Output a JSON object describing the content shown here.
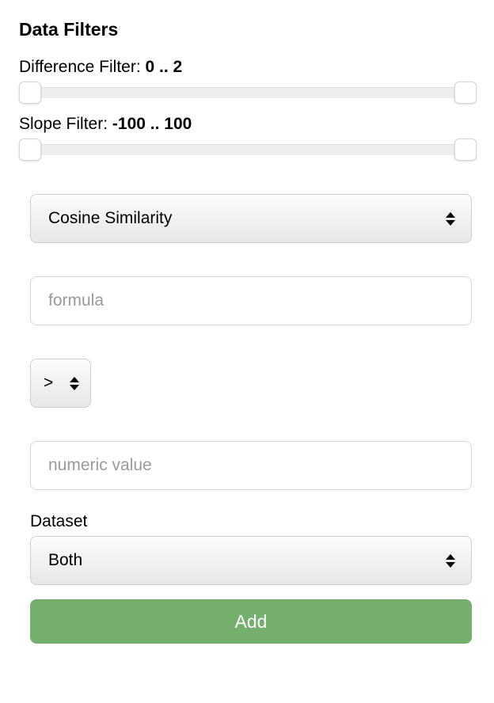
{
  "heading": "Data Filters",
  "difference_filter": {
    "label": "Difference Filter: ",
    "range": "0 .. 2"
  },
  "slope_filter": {
    "label": "Slope Filter: ",
    "range": "-100 .. 100"
  },
  "similarity_select": {
    "value": "Cosine Similarity"
  },
  "formula_input": {
    "placeholder": "formula",
    "value": ""
  },
  "comparator_select": {
    "value": ">"
  },
  "numeric_input": {
    "placeholder": "numeric value",
    "value": ""
  },
  "dataset": {
    "label": "Dataset",
    "value": "Both"
  },
  "add_button": "Add"
}
